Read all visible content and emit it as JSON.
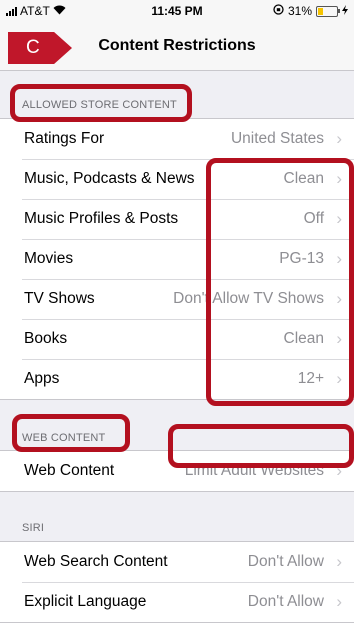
{
  "status_bar": {
    "carrier": "AT&T",
    "time": "11:45 PM",
    "battery_percent": "31%",
    "battery_level": 0.31,
    "icons": [
      "signal-icon",
      "wifi-icon",
      "rotation-lock-icon",
      "battery-icon",
      "charging-icon"
    ]
  },
  "nav": {
    "title": "Content Restrictions",
    "back_badge": "C",
    "accent": "#c0172a"
  },
  "sections": {
    "allowed_store_content": {
      "header": "ALLOWED STORE CONTENT",
      "rows": [
        {
          "label": "Ratings For",
          "value": "United States"
        },
        {
          "label": "Music, Podcasts & News",
          "value": "Clean"
        },
        {
          "label": "Music Profiles & Posts",
          "value": "Off"
        },
        {
          "label": "Movies",
          "value": "PG-13"
        },
        {
          "label": "TV Shows",
          "value": "Don't Allow TV Shows"
        },
        {
          "label": "Books",
          "value": "Clean"
        },
        {
          "label": "Apps",
          "value": "12+"
        }
      ]
    },
    "web_content": {
      "header": "WEB CONTENT",
      "rows": [
        {
          "label": "Web Content",
          "value": "Limit Adult Websites"
        }
      ]
    },
    "siri": {
      "header": "SIRI",
      "rows": [
        {
          "label": "Web Search Content",
          "value": "Don't Allow"
        },
        {
          "label": "Explicit Language",
          "value": "Don't Allow"
        }
      ]
    }
  },
  "annotation_color": "#b3101f"
}
